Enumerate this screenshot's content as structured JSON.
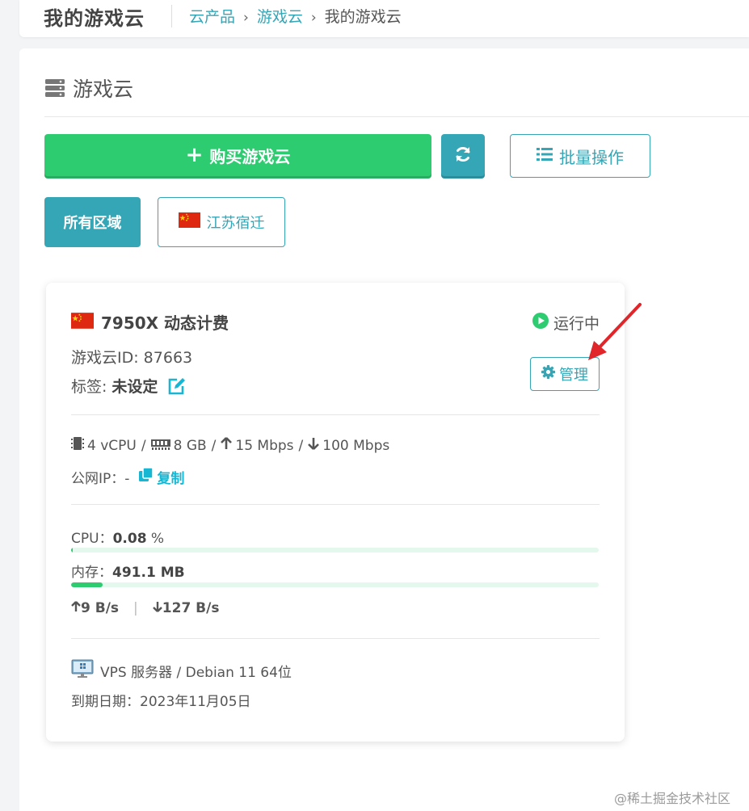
{
  "header": {
    "title": "我的游戏云",
    "breadcrumb": [
      "云产品",
      "游戏云",
      "我的游戏云"
    ]
  },
  "section": {
    "icon": "server-icon",
    "title": "游戏云"
  },
  "toolbar": {
    "buy_label": "购买游戏云",
    "refresh_icon": "refresh-icon",
    "batch_label": "批量操作"
  },
  "regions": {
    "all_label": "所有区域",
    "jiangsu_label": "江苏宿迁"
  },
  "server": {
    "name": "7950X 动态计费",
    "status": "运行中",
    "id_text": "游戏云ID: 87663",
    "tag_label": "标签:",
    "tag_value": "未设定",
    "manage_label": "管理",
    "specs": {
      "cpu": "4 vCPU",
      "ram": "8 GB",
      "up": "15 Mbps",
      "down": "100 Mbps"
    },
    "ip_label": "公网IP：-",
    "copy_label": "复制",
    "cpu_usage_label": "CPU：",
    "cpu_usage_value": "0.08",
    "cpu_usage_unit": " %",
    "cpu_usage_fraction": 0.0008,
    "mem_label": "内存：",
    "mem_value": "491.1 MB",
    "mem_fraction": 0.06,
    "net_up": "9 B/s",
    "net_down": "127 B/s",
    "os": "VPS 服务器 / Debian 11 64位",
    "expiry": "到期日期：2023年11月05日"
  },
  "colors": {
    "teal": "#35a6b6",
    "green": "#2ecc71",
    "arrow": "#e0262b"
  },
  "watermark": "@稀土掘金技术社区"
}
